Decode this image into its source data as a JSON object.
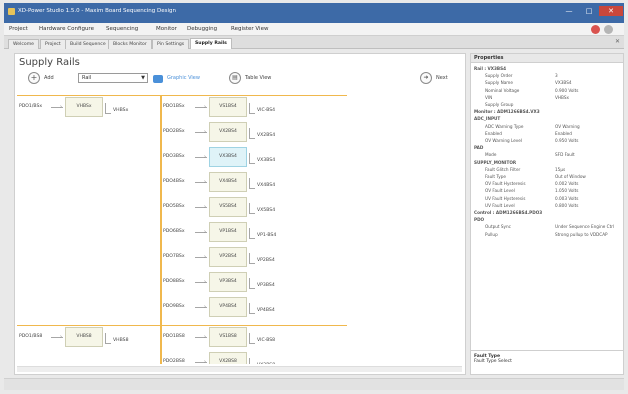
{
  "window": {
    "title": "XD-Power Studio 1.5.0 - Maxim Board Sequencing Design"
  },
  "menu": {
    "items": [
      "Project",
      "Hardware Configure",
      "Sequencing",
      "Monitor",
      "Debugging",
      "Register View"
    ]
  },
  "tabs": [
    "Welcome",
    "Project",
    "Build Sequence",
    "Blocks Monitor",
    "Pin Settings",
    "Supply Rails"
  ],
  "page": {
    "title": "Supply Rails",
    "add_label": "Add",
    "combo_value": "Rail",
    "graphic_view": "Graphic View",
    "table_view": "Table View",
    "next_label": "Next"
  },
  "diagram": {
    "left_rows": [
      {
        "in": "PDO1/BSx",
        "node": "VHBSx",
        "out": "VHBSx"
      },
      {
        "in": "PDO1/BS8",
        "node": "VHBS8",
        "out": "VHBS8"
      }
    ],
    "right_rows": [
      {
        "in": "PDO1BSx",
        "node": "VS1BS4",
        "out": "VIC-BS4",
        "hl": false
      },
      {
        "in": "PDO2BSx",
        "node": "VX2BS4",
        "out": "VX2BS4",
        "hl": false
      },
      {
        "in": "PDO3BSx",
        "node": "VX3BS4",
        "out": "VX3BS4",
        "hl": true
      },
      {
        "in": "PDO4BSx",
        "node": "VX4BS4",
        "out": "VX4BS4",
        "hl": false
      },
      {
        "in": "PDO5BSx",
        "node": "VS5BS4",
        "out": "VX5BS4",
        "hl": false
      },
      {
        "in": "PDO6BSx",
        "node": "VP1BS4",
        "out": "VP1-BS4",
        "hl": false
      },
      {
        "in": "PDO7BSx",
        "node": "VP2BS4",
        "out": "VP2BS4",
        "hl": false
      },
      {
        "in": "PDO8BSx",
        "node": "VP3BS4",
        "out": "VP3BS4",
        "hl": false
      },
      {
        "in": "PDO9BSx",
        "node": "VP4BS4",
        "out": "VP4BS4",
        "hl": false
      },
      {
        "in": "PDO1BS8",
        "node": "VS1BS8",
        "out": "VIC-BS8",
        "hl": false
      },
      {
        "in": "PDO2BS8",
        "node": "VX2BS8",
        "out": "VX2BS8",
        "hl": false
      }
    ]
  },
  "properties": {
    "header": "Properties",
    "rows": [
      {
        "k": "Rail : VX3BS4",
        "v": "",
        "sec": true
      },
      {
        "k": "Supply Order",
        "v": "3",
        "sec": false
      },
      {
        "k": "Supply Name",
        "v": "VX3BS4",
        "sec": false
      },
      {
        "k": "Nominal Voltage",
        "v": "0.900 Volts",
        "sec": false
      },
      {
        "k": "VIN",
        "v": "VHBSx",
        "sec": false
      },
      {
        "k": "Supply Group",
        "v": "",
        "sec": false
      },
      {
        "k": "Monitor : ADM1266BS4.VX3",
        "v": "",
        "sec": true
      },
      {
        "k": "ADC_INPUT",
        "v": "",
        "sec": true
      },
      {
        "k": "ADC Warning Type",
        "v": "OV Warning",
        "sec": false
      },
      {
        "k": "Enabled",
        "v": "Enabled",
        "sec": false
      },
      {
        "k": "OV Warning Level",
        "v": "0.950 Volts",
        "sec": false
      },
      {
        "k": "PAD",
        "v": "",
        "sec": true
      },
      {
        "k": "Mode",
        "v": "SFD Fault",
        "sec": false
      },
      {
        "k": "SUPPLY_MONITOR",
        "v": "",
        "sec": true
      },
      {
        "k": "Fault Glitch Filter",
        "v": "15µs",
        "sec": false
      },
      {
        "k": "Fault Type",
        "v": "Out of Window",
        "sec": false
      },
      {
        "k": "OV Fault Hysteresis",
        "v": "0.002 Volts",
        "sec": false
      },
      {
        "k": "OV Fault Level",
        "v": "1.050 Volts",
        "sec": false
      },
      {
        "k": "UV Fault Hysteresis",
        "v": "0.003 Volts",
        "sec": false
      },
      {
        "k": "UV Fault Level",
        "v": "0.800 Volts",
        "sec": false
      },
      {
        "k": "Control : ADM1266BS4.PDO3",
        "v": "",
        "sec": true
      },
      {
        "k": "PDO",
        "v": "",
        "sec": true
      },
      {
        "k": "Output Sync",
        "v": "Under Sequence Engine Ctrl",
        "sec": false
      },
      {
        "k": "Pullup",
        "v": "Strong pullup to VDDCAP",
        "sec": false
      }
    ],
    "desc_title": "Fault Type",
    "desc_text": "Fault Type Select"
  },
  "colors": {
    "titlebar": "#3d6aa7",
    "close": "#c9473b",
    "bus": "#f0b84d",
    "highlight": "#dff3f8"
  }
}
